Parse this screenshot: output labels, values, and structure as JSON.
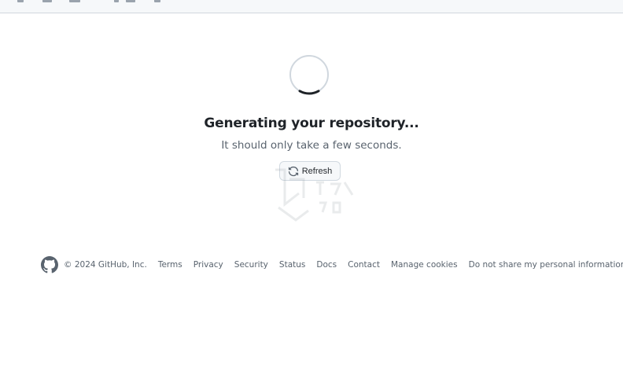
{
  "status": {
    "title": "Generating your repository...",
    "subtitle": "It should only take a few seconds.",
    "refresh_label": "Refresh"
  },
  "footer": {
    "copyright": "© 2024 GitHub, Inc.",
    "links": [
      "Terms",
      "Privacy",
      "Security",
      "Status",
      "Docs",
      "Contact",
      "Manage cookies",
      "Do not share my personal information"
    ]
  },
  "icons": {
    "spinner": "loading-spinner-icon",
    "refresh": "sync-icon",
    "logo": "github-mark-icon"
  },
  "colors": {
    "text": "#1f2328",
    "muted": "#59636e",
    "button_bg": "#f6f8fa",
    "border": "#d1d9e0"
  }
}
